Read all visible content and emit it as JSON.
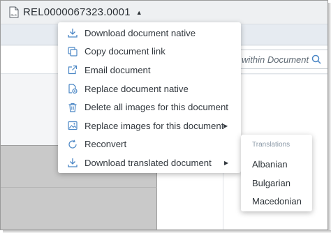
{
  "title": {
    "document_id": "REL0000067323.0001",
    "file_icon": "excel-file-icon"
  },
  "search": {
    "placeholder": "within Document"
  },
  "menu": {
    "items": [
      {
        "label": "Download document native",
        "icon": "download-icon"
      },
      {
        "label": "Copy document link",
        "icon": "copy-icon"
      },
      {
        "label": "Email document",
        "icon": "share-icon"
      },
      {
        "label": "Replace document native",
        "icon": "replace-file-icon"
      },
      {
        "label": "Delete all images for this document",
        "icon": "trash-icon"
      },
      {
        "label": "Replace images for this document",
        "icon": "image-icon"
      },
      {
        "label": "Reconvert",
        "icon": "refresh-icon"
      },
      {
        "label": "Download translated document",
        "icon": "download-icon"
      }
    ]
  },
  "translations": {
    "heading": "Translations",
    "languages": [
      "Albanian",
      "Bulgarian",
      "Macedonian"
    ]
  },
  "colors": {
    "icon_blue": "#4a86c5",
    "menu_text": "#33393f",
    "submenu_heading": "#8a98a6"
  }
}
